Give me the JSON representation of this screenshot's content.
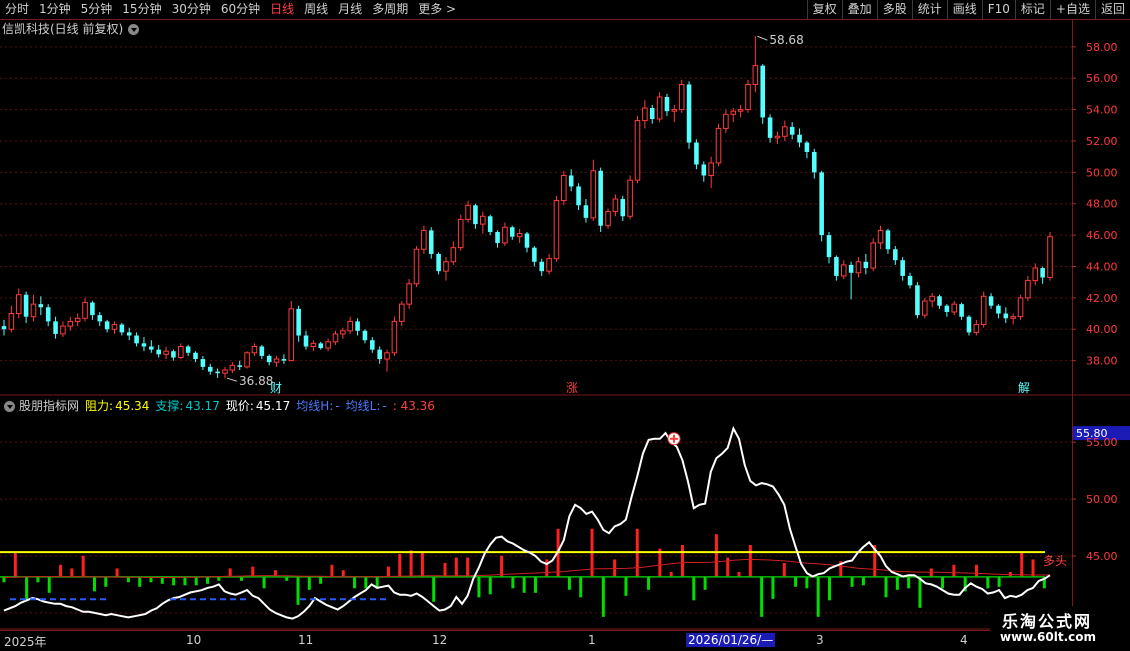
{
  "toolbar": {
    "periods": [
      "分时",
      "1分钟",
      "5分钟",
      "15分钟",
      "30分钟",
      "60分钟",
      "日线",
      "周线",
      "月线",
      "多周期",
      "更多"
    ],
    "active_index": 6,
    "actions": [
      "复权",
      "叠加",
      "多股",
      "统计",
      "画线",
      "F10",
      "标记",
      "+自选",
      "返回"
    ]
  },
  "main": {
    "title": "信凯科技(日线 前复权)",
    "high_label": "58.68",
    "low_label": "36.88",
    "markers": [
      "财",
      "涨",
      "解"
    ],
    "yaxis": [
      "58.00",
      "56.00",
      "54.00",
      "52.00",
      "50.00",
      "48.00",
      "46.00",
      "44.00",
      "42.00",
      "40.00",
      "38.00"
    ]
  },
  "indicator": {
    "name": "股朋指标网",
    "resistance_label": "阻力:",
    "resistance_value": "45.34",
    "support_label": "支撑:",
    "support_value": "43.17",
    "price_label": "现价:",
    "price_value": "45.17",
    "ma_h_label": "均线H:",
    "ma_h_value": "-",
    "ma_l_label": "均线L:",
    "ma_l_value": "-",
    "last_value": ": 43.36",
    "current_box": "55.80",
    "yaxis": [
      "55.00",
      "50.00",
      "45.00",
      "40.00"
    ],
    "tail_text": "多头"
  },
  "dates": [
    "2025年",
    "10",
    "11",
    "12",
    "1",
    "2026/01/26/—",
    "3",
    "4"
  ],
  "watermark": {
    "line1": "乐淘公式网",
    "line2": "www.60lt.com"
  },
  "colors": {
    "up": "#ff3b3b",
    "down": "#54ffff",
    "grid": "#5a1010",
    "yellow": "#ffff00",
    "green": "#00dd00",
    "white": "#ffffff"
  },
  "chart_data": [
    {
      "type": "candlestick",
      "title": "信凯科技(日线 前复权)",
      "ylim": [
        36.0,
        59.2
      ],
      "high": 58.68,
      "low": 36.88,
      "ohlc": [
        [
          40.2,
          40.6,
          39.6,
          40.0
        ],
        [
          40.0,
          41.5,
          39.8,
          41.0
        ],
        [
          41.0,
          42.6,
          40.7,
          42.2
        ],
        [
          42.2,
          42.4,
          40.4,
          40.8
        ],
        [
          40.8,
          42.2,
          40.5,
          41.6
        ],
        [
          41.6,
          42.1,
          40.9,
          41.4
        ],
        [
          41.4,
          41.6,
          40.2,
          40.5
        ],
        [
          40.5,
          40.8,
          39.4,
          39.7
        ],
        [
          39.7,
          40.5,
          39.5,
          40.2
        ],
        [
          40.2,
          40.8,
          39.9,
          40.5
        ],
        [
          40.5,
          41.0,
          40.2,
          40.7
        ],
        [
          40.7,
          42.0,
          40.5,
          41.7
        ],
        [
          41.7,
          41.8,
          40.6,
          40.9
        ],
        [
          40.9,
          41.1,
          40.2,
          40.5
        ],
        [
          40.5,
          40.6,
          39.8,
          40.0
        ],
        [
          40.0,
          40.5,
          39.7,
          40.3
        ],
        [
          40.3,
          40.4,
          39.6,
          39.8
        ],
        [
          39.8,
          40.1,
          39.3,
          39.6
        ],
        [
          39.6,
          39.8,
          38.9,
          39.1
        ],
        [
          39.1,
          39.5,
          38.6,
          38.9
        ],
        [
          38.9,
          39.3,
          38.5,
          38.7
        ],
        [
          38.7,
          39.0,
          38.2,
          38.4
        ],
        [
          38.4,
          38.9,
          38.1,
          38.6
        ],
        [
          38.6,
          38.7,
          38.0,
          38.2
        ],
        [
          38.2,
          39.1,
          38.1,
          38.9
        ],
        [
          38.9,
          39.0,
          38.3,
          38.5
        ],
        [
          38.5,
          38.6,
          37.9,
          38.1
        ],
        [
          38.1,
          38.3,
          37.4,
          37.6
        ],
        [
          37.6,
          37.8,
          37.1,
          37.3
        ],
        [
          37.3,
          37.5,
          36.9,
          37.2
        ],
        [
          37.2,
          37.6,
          36.88,
          37.4
        ],
        [
          37.4,
          37.9,
          37.2,
          37.7
        ],
        [
          37.7,
          38.0,
          37.4,
          37.6
        ],
        [
          37.6,
          38.6,
          37.5,
          38.5
        ],
        [
          38.5,
          39.1,
          38.3,
          38.9
        ],
        [
          38.9,
          39.0,
          38.1,
          38.3
        ],
        [
          38.3,
          38.4,
          37.7,
          37.9
        ],
        [
          37.9,
          38.3,
          37.6,
          38.1
        ],
        [
          38.1,
          38.4,
          37.8,
          38.0
        ],
        [
          38.0,
          41.8,
          38.0,
          41.3
        ],
        [
          41.3,
          41.5,
          39.2,
          39.6
        ],
        [
          39.6,
          39.9,
          38.7,
          38.9
        ],
        [
          38.9,
          39.3,
          38.6,
          39.1
        ],
        [
          39.1,
          39.2,
          38.7,
          38.8
        ],
        [
          38.8,
          39.4,
          38.6,
          39.2
        ],
        [
          39.2,
          39.9,
          39.0,
          39.7
        ],
        [
          39.7,
          40.1,
          39.4,
          39.9
        ],
        [
          39.9,
          40.8,
          39.7,
          40.5
        ],
        [
          40.5,
          40.7,
          39.6,
          39.9
        ],
        [
          39.9,
          40.0,
          39.1,
          39.3
        ],
        [
          39.3,
          39.5,
          38.5,
          38.7
        ],
        [
          38.7,
          38.9,
          37.8,
          38.1
        ],
        [
          38.1,
          38.7,
          37.3,
          38.5
        ],
        [
          38.5,
          40.8,
          38.3,
          40.5
        ],
        [
          40.5,
          41.8,
          40.2,
          41.6
        ],
        [
          41.6,
          43.2,
          41.3,
          42.9
        ],
        [
          42.9,
          45.3,
          42.7,
          45.1
        ],
        [
          45.1,
          46.6,
          44.8,
          46.3
        ],
        [
          46.3,
          46.5,
          44.5,
          44.8
        ],
        [
          44.8,
          44.9,
          43.5,
          43.7
        ],
        [
          43.7,
          44.6,
          43.1,
          44.3
        ],
        [
          44.3,
          45.6,
          44.1,
          45.2
        ],
        [
          45.2,
          47.3,
          45.0,
          47.0
        ],
        [
          47.0,
          48.2,
          46.8,
          47.9
        ],
        [
          47.9,
          48.0,
          46.4,
          46.7
        ],
        [
          46.7,
          47.5,
          46.1,
          47.2
        ],
        [
          47.2,
          47.3,
          46.0,
          46.2
        ],
        [
          46.2,
          46.3,
          45.2,
          45.5
        ],
        [
          45.5,
          46.8,
          45.3,
          46.5
        ],
        [
          46.5,
          46.6,
          45.7,
          45.9
        ],
        [
          45.9,
          46.4,
          45.5,
          46.1
        ],
        [
          46.1,
          46.2,
          44.9,
          45.2
        ],
        [
          45.2,
          45.3,
          44.0,
          44.3
        ],
        [
          44.3,
          44.5,
          43.4,
          43.7
        ],
        [
          43.7,
          44.8,
          43.5,
          44.5
        ],
        [
          44.5,
          48.5,
          44.3,
          48.2
        ],
        [
          48.2,
          50.1,
          47.9,
          49.8
        ],
        [
          49.8,
          50.2,
          48.8,
          49.1
        ],
        [
          49.1,
          49.3,
          47.6,
          47.9
        ],
        [
          47.9,
          48.3,
          46.8,
          47.1
        ],
        [
          47.1,
          50.8,
          46.9,
          50.1
        ],
        [
          50.1,
          50.3,
          46.2,
          46.6
        ],
        [
          46.6,
          47.7,
          46.4,
          47.5
        ],
        [
          47.5,
          48.6,
          47.2,
          48.3
        ],
        [
          48.3,
          48.5,
          46.9,
          47.2
        ],
        [
          47.2,
          49.8,
          47.0,
          49.5
        ],
        [
          49.5,
          53.6,
          49.3,
          53.3
        ],
        [
          53.3,
          54.6,
          52.8,
          54.1
        ],
        [
          54.1,
          54.3,
          53.1,
          53.4
        ],
        [
          53.4,
          55.1,
          53.2,
          54.8
        ],
        [
          54.8,
          55.0,
          53.6,
          53.9
        ],
        [
          53.9,
          54.3,
          53.2,
          54.0
        ],
        [
          54.0,
          55.9,
          53.8,
          55.6
        ],
        [
          55.6,
          55.8,
          51.5,
          51.9
        ],
        [
          51.9,
          52.1,
          50.2,
          50.5
        ],
        [
          50.5,
          50.7,
          49.4,
          49.8
        ],
        [
          49.8,
          51.0,
          49.0,
          50.6
        ],
        [
          50.6,
          53.1,
          50.4,
          52.8
        ],
        [
          52.8,
          54.0,
          52.5,
          53.7
        ],
        [
          53.7,
          54.1,
          53.2,
          53.9
        ],
        [
          53.9,
          54.3,
          53.5,
          54.0
        ],
        [
          54.0,
          55.9,
          53.8,
          55.6
        ],
        [
          55.6,
          58.68,
          55.1,
          56.8
        ],
        [
          56.8,
          56.9,
          53.1,
          53.5
        ],
        [
          53.5,
          53.7,
          51.9,
          52.2
        ],
        [
          52.2,
          52.6,
          51.8,
          52.3
        ],
        [
          52.3,
          53.3,
          52.0,
          52.9
        ],
        [
          52.9,
          53.2,
          52.1,
          52.4
        ],
        [
          52.4,
          52.8,
          51.6,
          51.9
        ],
        [
          51.9,
          52.0,
          50.9,
          51.3
        ],
        [
          51.3,
          51.5,
          49.6,
          50.0
        ],
        [
          50.0,
          50.1,
          45.6,
          46.0
        ],
        [
          46.0,
          46.2,
          44.2,
          44.6
        ],
        [
          44.6,
          44.7,
          43.1,
          43.4
        ],
        [
          43.4,
          44.4,
          43.2,
          44.1
        ],
        [
          44.1,
          44.3,
          41.9,
          43.6
        ],
        [
          43.6,
          44.6,
          43.3,
          44.3
        ],
        [
          44.3,
          44.8,
          43.5,
          43.9
        ],
        [
          43.9,
          45.8,
          43.7,
          45.5
        ],
        [
          45.5,
          46.6,
          45.1,
          46.3
        ],
        [
          46.3,
          46.4,
          44.8,
          45.1
        ],
        [
          45.1,
          45.3,
          44.1,
          44.4
        ],
        [
          44.4,
          44.6,
          43.1,
          43.4
        ],
        [
          43.4,
          43.6,
          42.6,
          42.8
        ],
        [
          42.8,
          43.0,
          40.7,
          40.9
        ],
        [
          40.9,
          42.0,
          40.7,
          41.8
        ],
        [
          41.8,
          42.3,
          41.4,
          42.1
        ],
        [
          42.1,
          42.2,
          41.3,
          41.5
        ],
        [
          41.5,
          41.6,
          40.8,
          41.1
        ],
        [
          41.1,
          41.8,
          40.9,
          41.6
        ],
        [
          41.6,
          41.7,
          40.6,
          40.8
        ],
        [
          40.8,
          40.9,
          39.6,
          39.8
        ],
        [
          39.8,
          40.6,
          39.6,
          40.3
        ],
        [
          40.3,
          42.4,
          40.1,
          42.1
        ],
        [
          42.1,
          42.3,
          41.3,
          41.5
        ],
        [
          41.5,
          41.6,
          40.7,
          41.0
        ],
        [
          41.0,
          41.4,
          40.4,
          40.7
        ],
        [
          40.7,
          41.0,
          40.3,
          40.8
        ],
        [
          40.8,
          42.2,
          40.6,
          42.0
        ],
        [
          42.0,
          43.4,
          41.8,
          43.1
        ],
        [
          43.1,
          44.2,
          42.8,
          43.9
        ],
        [
          43.9,
          44.0,
          42.9,
          43.3
        ],
        [
          43.3,
          46.2,
          43.1,
          45.9
        ]
      ]
    },
    {
      "type": "line",
      "title": "股朋指标网",
      "ylim": [
        39.2,
        57.3
      ],
      "series": [
        {
          "name": "现价",
          "values": [
            40.2,
            40.4,
            40.6,
            40.9,
            41.1,
            41.3,
            41.2,
            41.0,
            40.9,
            40.8,
            40.8,
            40.6,
            40.5,
            40.3,
            40.1,
            40.1,
            40.0,
            39.9,
            39.8,
            39.9,
            39.8,
            39.7,
            39.6,
            39.7,
            39.8,
            39.9,
            40.2,
            40.4,
            40.8,
            41.1,
            41.3,
            41.4,
            41.6,
            41.8,
            41.9,
            42.0,
            42.2,
            42.3,
            42.5,
            41.9,
            41.7,
            41.6,
            41.8,
            42.0,
            41.5,
            41.3,
            40.8,
            40.3,
            40.0,
            39.8,
            39.6,
            39.5,
            39.7,
            40.1,
            40.6,
            41.3,
            41.0,
            40.7,
            40.5,
            40.3,
            40.6,
            41.0,
            41.4,
            41.7,
            42.0,
            42.5,
            42.2,
            42.3,
            42.4,
            41.8,
            41.6,
            41.6,
            41.5,
            41.7,
            41.4,
            41.0,
            40.6,
            40.2,
            40.3,
            40.6,
            41.4,
            40.8,
            41.5,
            43.0,
            44.0,
            45.2,
            46.0,
            46.6,
            46.7,
            46.3,
            46.1,
            45.8,
            45.5,
            45.3,
            45.0,
            44.5,
            44.3,
            44.6,
            45.4,
            46.4,
            48.5,
            49.5,
            49.2,
            48.7,
            48.9,
            48.2,
            47.3,
            47.0,
            47.6,
            47.8,
            48.2,
            50.2,
            52.0,
            54.0,
            55.2,
            55.3,
            55.3,
            55.8,
            55.0,
            54.6,
            53.4,
            51.5,
            49.2,
            49.5,
            49.6,
            52.4,
            53.6,
            54.0,
            54.5,
            56.2,
            55.3,
            53.0,
            51.6,
            51.2,
            51.4,
            51.3,
            51.1,
            50.4,
            49.5,
            47.4,
            45.8,
            44.3,
            43.5,
            43.2,
            43.4,
            43.5,
            43.9,
            44.1,
            44.3,
            44.5,
            44.6,
            45.3,
            45.8,
            46.2,
            45.6,
            45.0,
            44.1,
            43.6,
            43.4,
            43.2,
            43.3,
            43.3,
            43.0,
            42.6,
            42.5,
            42.3,
            42.0,
            41.7,
            41.6,
            41.6,
            42.2,
            42.6,
            42.3,
            42.1,
            41.7,
            41.8,
            42.0,
            41.3,
            41.5,
            41.4,
            41.6,
            42.0,
            42.2,
            42.8,
            43.0,
            43.3
          ]
        }
      ],
      "levels": {
        "resistance": 45.34,
        "support": 43.17
      }
    }
  ]
}
